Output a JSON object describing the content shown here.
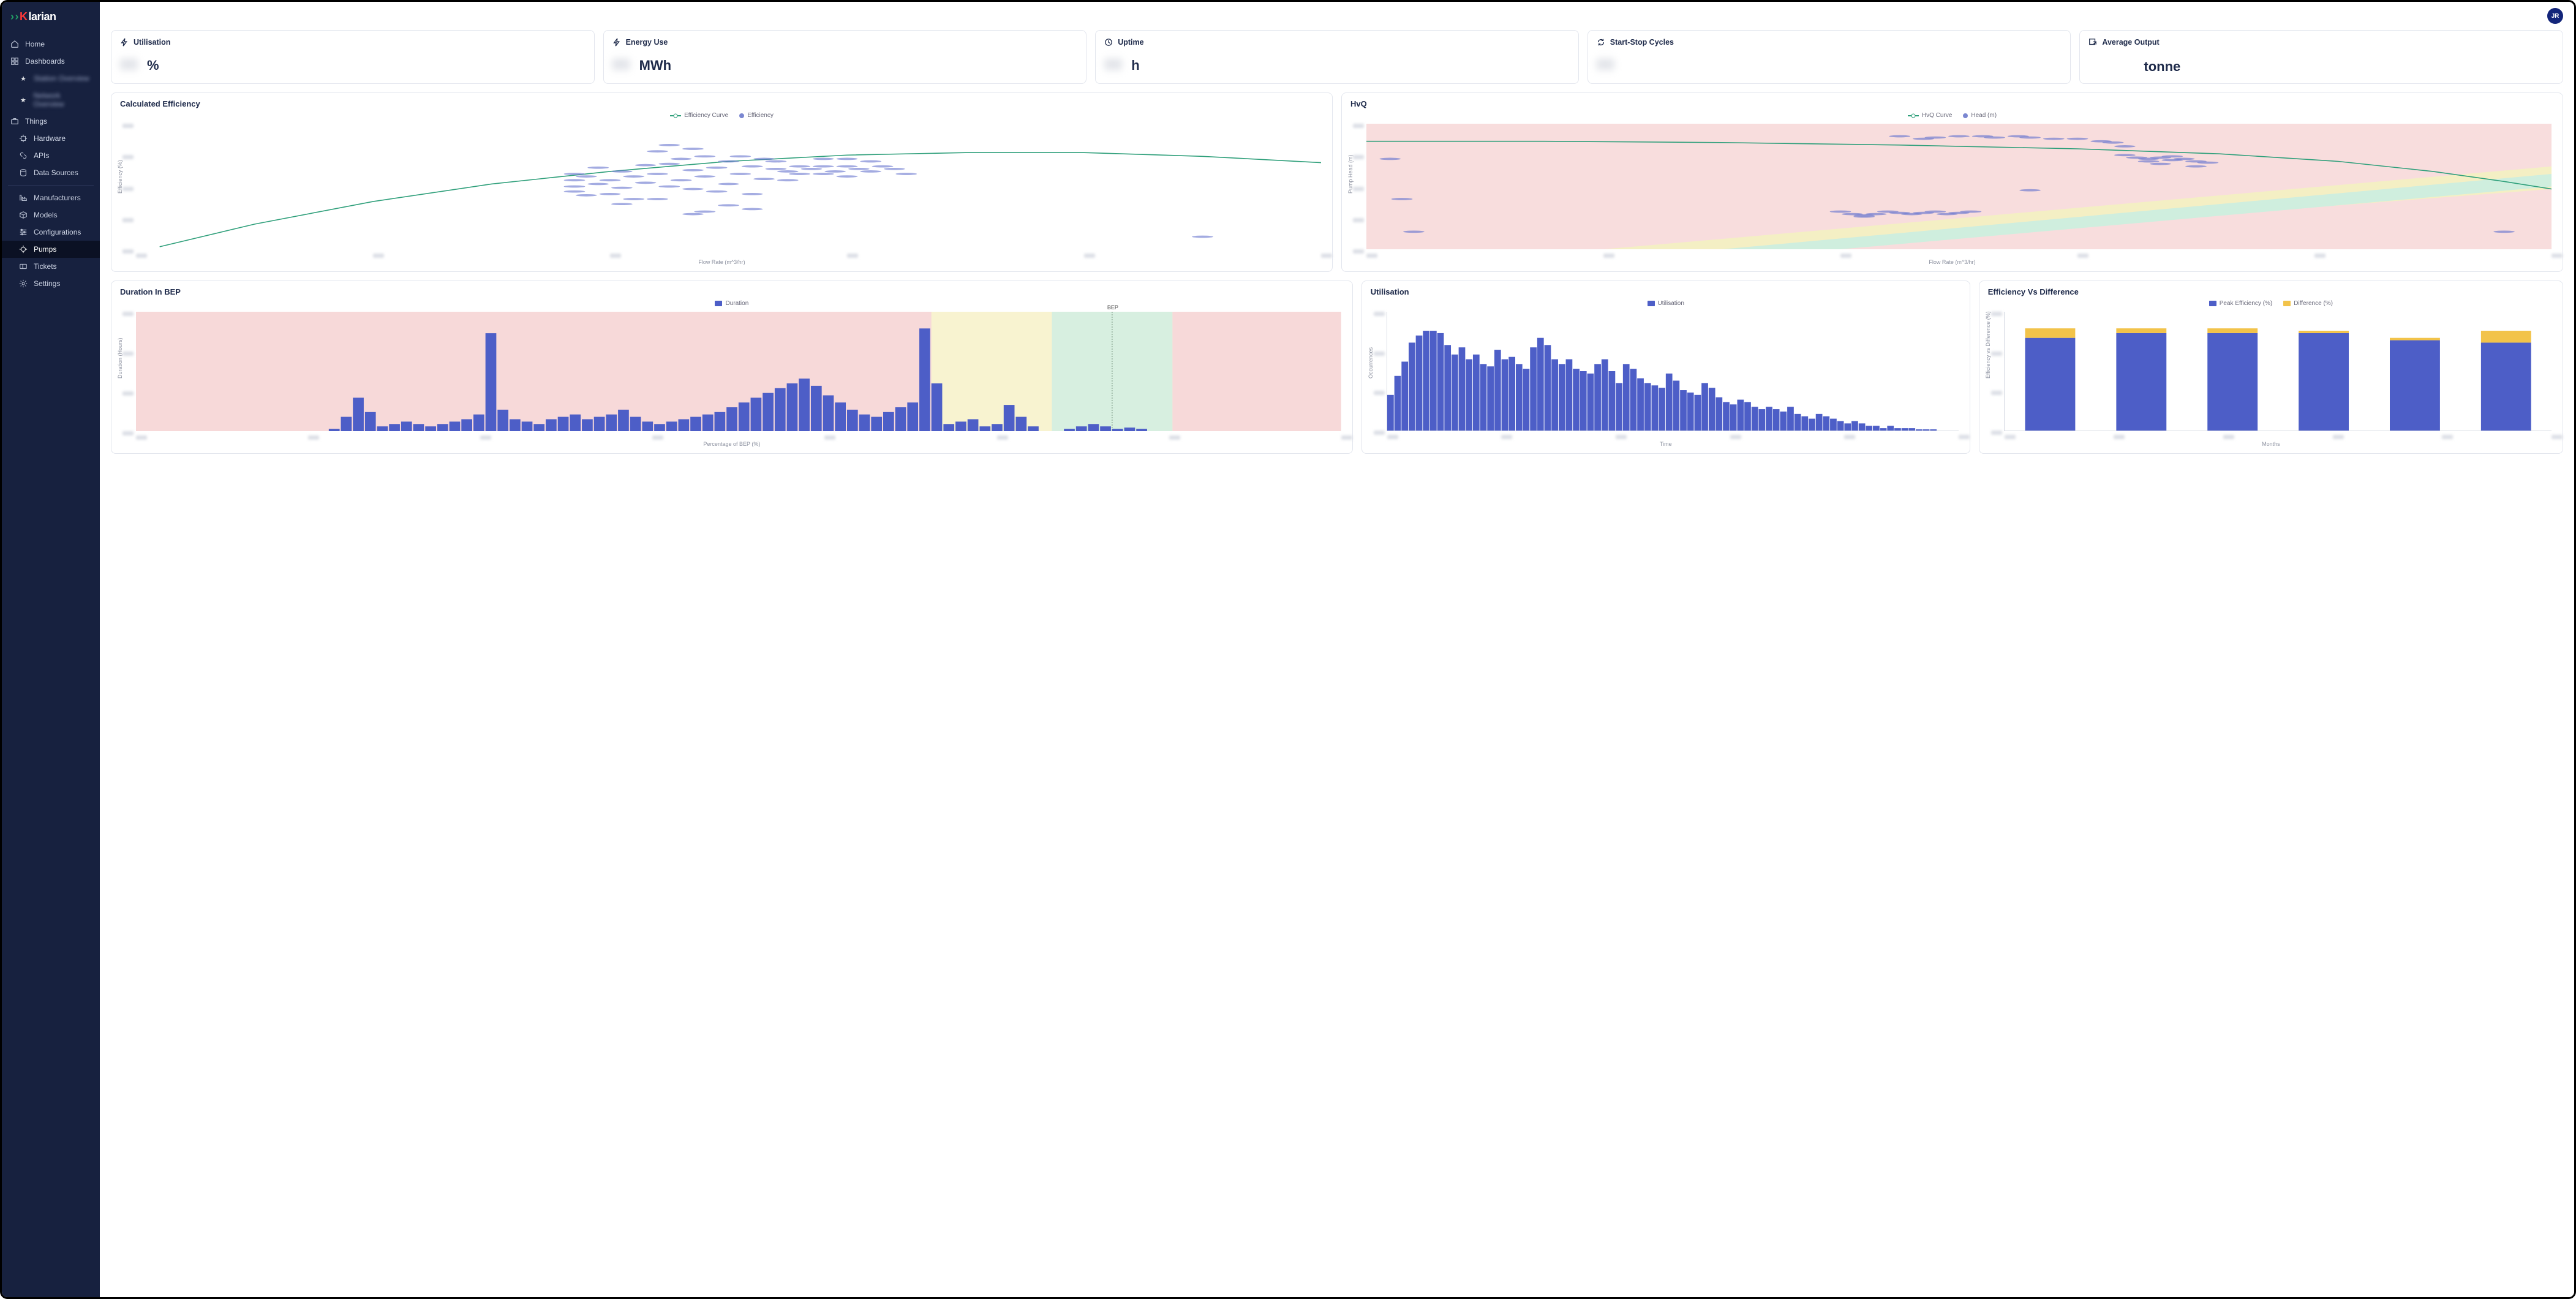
{
  "brand": {
    "chev": "›",
    "k": "K",
    "rest": "larian"
  },
  "user": {
    "initials": "JR"
  },
  "sidebar": {
    "home": "Home",
    "dashboards": "Dashboards",
    "fav1": "Station Overview",
    "fav2": "Network Overview",
    "things": "Things",
    "hardware": "Hardware",
    "apis": "APIs",
    "data_sources": "Data Sources",
    "manufacturers": "Manufacturers",
    "models": "Models",
    "configurations": "Configurations",
    "pumps": "Pumps",
    "tickets": "Tickets",
    "settings": "Settings"
  },
  "kpi": {
    "utilisation": {
      "label": "Utilisation",
      "unit": "%"
    },
    "energy": {
      "label": "Energy Use",
      "unit": "MWh"
    },
    "uptime": {
      "label": "Uptime",
      "unit": "h"
    },
    "cycles": {
      "label": "Start-Stop Cycles",
      "unit": ""
    },
    "output": {
      "label": "Average Output",
      "unit": "tonne"
    }
  },
  "charts": {
    "eff": {
      "title": "Calculated Efficiency",
      "legend_curve": "Efficiency Curve",
      "legend_pts": "Efficiency",
      "xlabel": "Flow Rate (m^3/hr)",
      "ylabel": "Efficiency (%)"
    },
    "hvq": {
      "title": "HvQ",
      "legend_curve": "HvQ Curve",
      "legend_pts": "Head (m)",
      "xlabel": "Flow Rate (m^3/hr)",
      "ylabel": "Pump Head (m)"
    },
    "bep": {
      "title": "Duration In BEP",
      "legend": "Duration",
      "marker": "BEP",
      "xlabel": "Percentage of BEP (%)",
      "ylabel": "Duration (Hours)"
    },
    "util": {
      "title": "Utilisation",
      "legend": "Utilisation",
      "xlabel": "Time",
      "ylabel": "Occurrences"
    },
    "effdiff": {
      "title": "Efficiency Vs Difference",
      "legend1": "Peak Efficiency (%)",
      "legend2": "Difference (%)",
      "xlabel": "Months",
      "ylabel": "Efficiency vs Difference (%)"
    }
  },
  "chart_data": [
    {
      "id": "calculated_efficiency",
      "type": "scatter+line",
      "title": "Calculated Efficiency",
      "xlabel": "Flow Rate (m^3/hr)",
      "ylabel": "Efficiency (%)",
      "note": "axis tick values redacted in source image; x/y given as 0–100 relative positions within the plot area",
      "lines": [
        {
          "name": "Efficiency Curve",
          "color": "#2e9f7a",
          "points": [
            [
              2,
              2
            ],
            [
              10,
              20
            ],
            [
              20,
              38
            ],
            [
              30,
              52
            ],
            [
              40,
              62
            ],
            [
              50,
              70
            ],
            [
              60,
              75
            ],
            [
              70,
              77
            ],
            [
              80,
              77
            ],
            [
              90,
              74
            ],
            [
              100,
              69
            ]
          ]
        }
      ],
      "scatter": {
        "name": "Efficiency",
        "color": "#7b87d1",
        "points": [
          [
            37,
            46
          ],
          [
            37,
            50
          ],
          [
            37,
            55
          ],
          [
            37,
            60
          ],
          [
            38,
            43
          ],
          [
            38,
            58
          ],
          [
            39,
            52
          ],
          [
            39,
            65
          ],
          [
            40,
            44
          ],
          [
            40,
            55
          ],
          [
            41,
            36
          ],
          [
            41,
            49
          ],
          [
            41,
            62
          ],
          [
            42,
            40
          ],
          [
            42,
            58
          ],
          [
            43,
            53
          ],
          [
            43,
            67
          ],
          [
            44,
            40
          ],
          [
            44,
            60
          ],
          [
            44,
            78
          ],
          [
            45,
            50
          ],
          [
            45,
            68
          ],
          [
            45,
            83
          ],
          [
            46,
            55
          ],
          [
            46,
            72
          ],
          [
            47,
            48
          ],
          [
            47,
            63
          ],
          [
            47,
            80
          ],
          [
            48,
            58
          ],
          [
            48,
            74
          ],
          [
            49,
            65
          ],
          [
            49,
            46
          ],
          [
            50,
            70
          ],
          [
            50,
            52
          ],
          [
            51,
            60
          ],
          [
            51,
            74
          ],
          [
            52,
            44
          ],
          [
            52,
            66
          ],
          [
            53,
            72
          ],
          [
            53,
            56
          ],
          [
            54,
            64
          ],
          [
            54,
            70
          ],
          [
            55,
            62
          ],
          [
            56,
            66
          ],
          [
            56,
            60
          ],
          [
            57,
            64
          ],
          [
            58,
            60
          ],
          [
            58,
            66
          ],
          [
            59,
            62
          ],
          [
            60,
            66
          ],
          [
            60,
            58
          ],
          [
            61,
            64
          ],
          [
            62,
            62
          ],
          [
            63,
            66
          ],
          [
            64,
            64
          ],
          [
            65,
            60
          ],
          [
            58,
            72
          ],
          [
            60,
            72
          ],
          [
            62,
            70
          ],
          [
            55,
            55
          ],
          [
            50,
            35
          ],
          [
            47,
            28
          ],
          [
            48,
            30
          ],
          [
            52,
            32
          ],
          [
            90,
            10
          ]
        ]
      }
    },
    {
      "id": "hvq",
      "type": "scatter+line",
      "title": "HvQ",
      "xlabel": "Flow Rate (m^3/hr)",
      "ylabel": "Pump Head (m)",
      "note": "relative units 0–100; background has red (off-range), yellow and green guide bands",
      "lines": [
        {
          "name": "HvQ Curve",
          "color": "#2e9f7a",
          "points": [
            [
              0,
              86
            ],
            [
              15,
              86
            ],
            [
              30,
              85
            ],
            [
              45,
              83
            ],
            [
              60,
              80
            ],
            [
              72,
              76
            ],
            [
              82,
              70
            ],
            [
              90,
              62
            ],
            [
              96,
              54
            ],
            [
              100,
              48
            ]
          ]
        }
      ],
      "scatter": {
        "name": "Head (m)",
        "color": "#7b87d1",
        "points": [
          [
            45,
            90
          ],
          [
            47,
            88
          ],
          [
            48,
            89
          ],
          [
            50,
            90
          ],
          [
            52,
            90
          ],
          [
            53,
            89
          ],
          [
            55,
            90
          ],
          [
            56,
            89
          ],
          [
            58,
            88
          ],
          [
            60,
            88
          ],
          [
            62,
            86
          ],
          [
            63,
            85
          ],
          [
            64,
            82
          ],
          [
            64,
            75
          ],
          [
            65,
            73
          ],
          [
            66,
            72
          ],
          [
            66,
            70
          ],
          [
            67,
            68
          ],
          [
            67,
            73
          ],
          [
            68,
            71
          ],
          [
            68,
            74
          ],
          [
            69,
            72
          ],
          [
            70,
            70
          ],
          [
            70,
            66
          ],
          [
            71,
            69
          ],
          [
            40,
            30
          ],
          [
            41,
            28
          ],
          [
            42,
            27
          ],
          [
            42,
            26
          ],
          [
            43,
            28
          ],
          [
            44,
            30
          ],
          [
            45,
            29
          ],
          [
            46,
            28
          ],
          [
            47,
            29
          ],
          [
            48,
            30
          ],
          [
            49,
            28
          ],
          [
            50,
            29
          ],
          [
            51,
            30
          ],
          [
            2,
            72
          ],
          [
            3,
            40
          ],
          [
            4,
            14
          ],
          [
            56,
            47
          ],
          [
            96,
            14
          ]
        ]
      }
    },
    {
      "id": "duration_in_bep",
      "type": "bar",
      "title": "Duration In BEP",
      "xlabel": "Percentage of BEP (%)",
      "ylabel": "Duration (Hours)",
      "note": "relative units 0–100; BEP marker at ~81% with green/yellow bands around it and red elsewhere",
      "series": [
        {
          "name": "Duration",
          "values": [
            0,
            0,
            0,
            0,
            0,
            0,
            0,
            0,
            0,
            0,
            0,
            0,
            0,
            0,
            0,
            0,
            2,
            12,
            28,
            16,
            4,
            6,
            8,
            6,
            4,
            6,
            8,
            10,
            14,
            82,
            18,
            10,
            8,
            6,
            10,
            12,
            14,
            10,
            12,
            14,
            18,
            12,
            8,
            6,
            8,
            10,
            12,
            14,
            16,
            20,
            24,
            28,
            32,
            36,
            40,
            44,
            38,
            30,
            24,
            18,
            14,
            12,
            16,
            20,
            24,
            86,
            40,
            6,
            8,
            10,
            4,
            6,
            22,
            12,
            4,
            0,
            0,
            2,
            4,
            6,
            4,
            2,
            3,
            2,
            0,
            0,
            0,
            0,
            0,
            0,
            0,
            0,
            0,
            0,
            0,
            0,
            0,
            0,
            0,
            0
          ]
        }
      ],
      "bep_position": 81,
      "yellow_band": [
        66,
        86
      ],
      "green_band": [
        76,
        86
      ]
    },
    {
      "id": "utilisation_hist",
      "type": "bar",
      "title": "Utilisation",
      "xlabel": "Time",
      "ylabel": "Occurrences",
      "note": "relative heights 0–100",
      "series": [
        {
          "name": "Utilisation",
          "values": [
            30,
            46,
            58,
            74,
            80,
            84,
            84,
            82,
            72,
            64,
            70,
            60,
            64,
            56,
            54,
            68,
            60,
            62,
            56,
            52,
            70,
            78,
            72,
            60,
            56,
            60,
            52,
            50,
            48,
            56,
            60,
            50,
            40,
            56,
            52,
            44,
            40,
            38,
            36,
            48,
            42,
            34,
            32,
            30,
            40,
            36,
            28,
            24,
            22,
            26,
            24,
            20,
            18,
            20,
            18,
            16,
            20,
            14,
            12,
            10,
            14,
            12,
            10,
            8,
            6,
            8,
            6,
            4,
            4,
            2,
            4,
            2,
            2,
            2,
            1,
            1,
            1,
            0,
            0,
            0
          ]
        }
      ]
    },
    {
      "id": "efficiency_vs_difference",
      "type": "bar",
      "title": "Efficiency Vs Difference",
      "xlabel": "Months",
      "ylabel": "Efficiency vs Difference (%)",
      "note": "relative heights 0–100; stacked bars, 6 months",
      "bars": 6,
      "series": [
        {
          "name": "Peak Efficiency (%)",
          "color": "#4d5ec7",
          "values": [
            78,
            82,
            82,
            82,
            76,
            74
          ]
        },
        {
          "name": "Difference (%)",
          "color": "#f2c34a",
          "values": [
            8,
            4,
            4,
            2,
            2,
            10
          ]
        }
      ]
    }
  ]
}
